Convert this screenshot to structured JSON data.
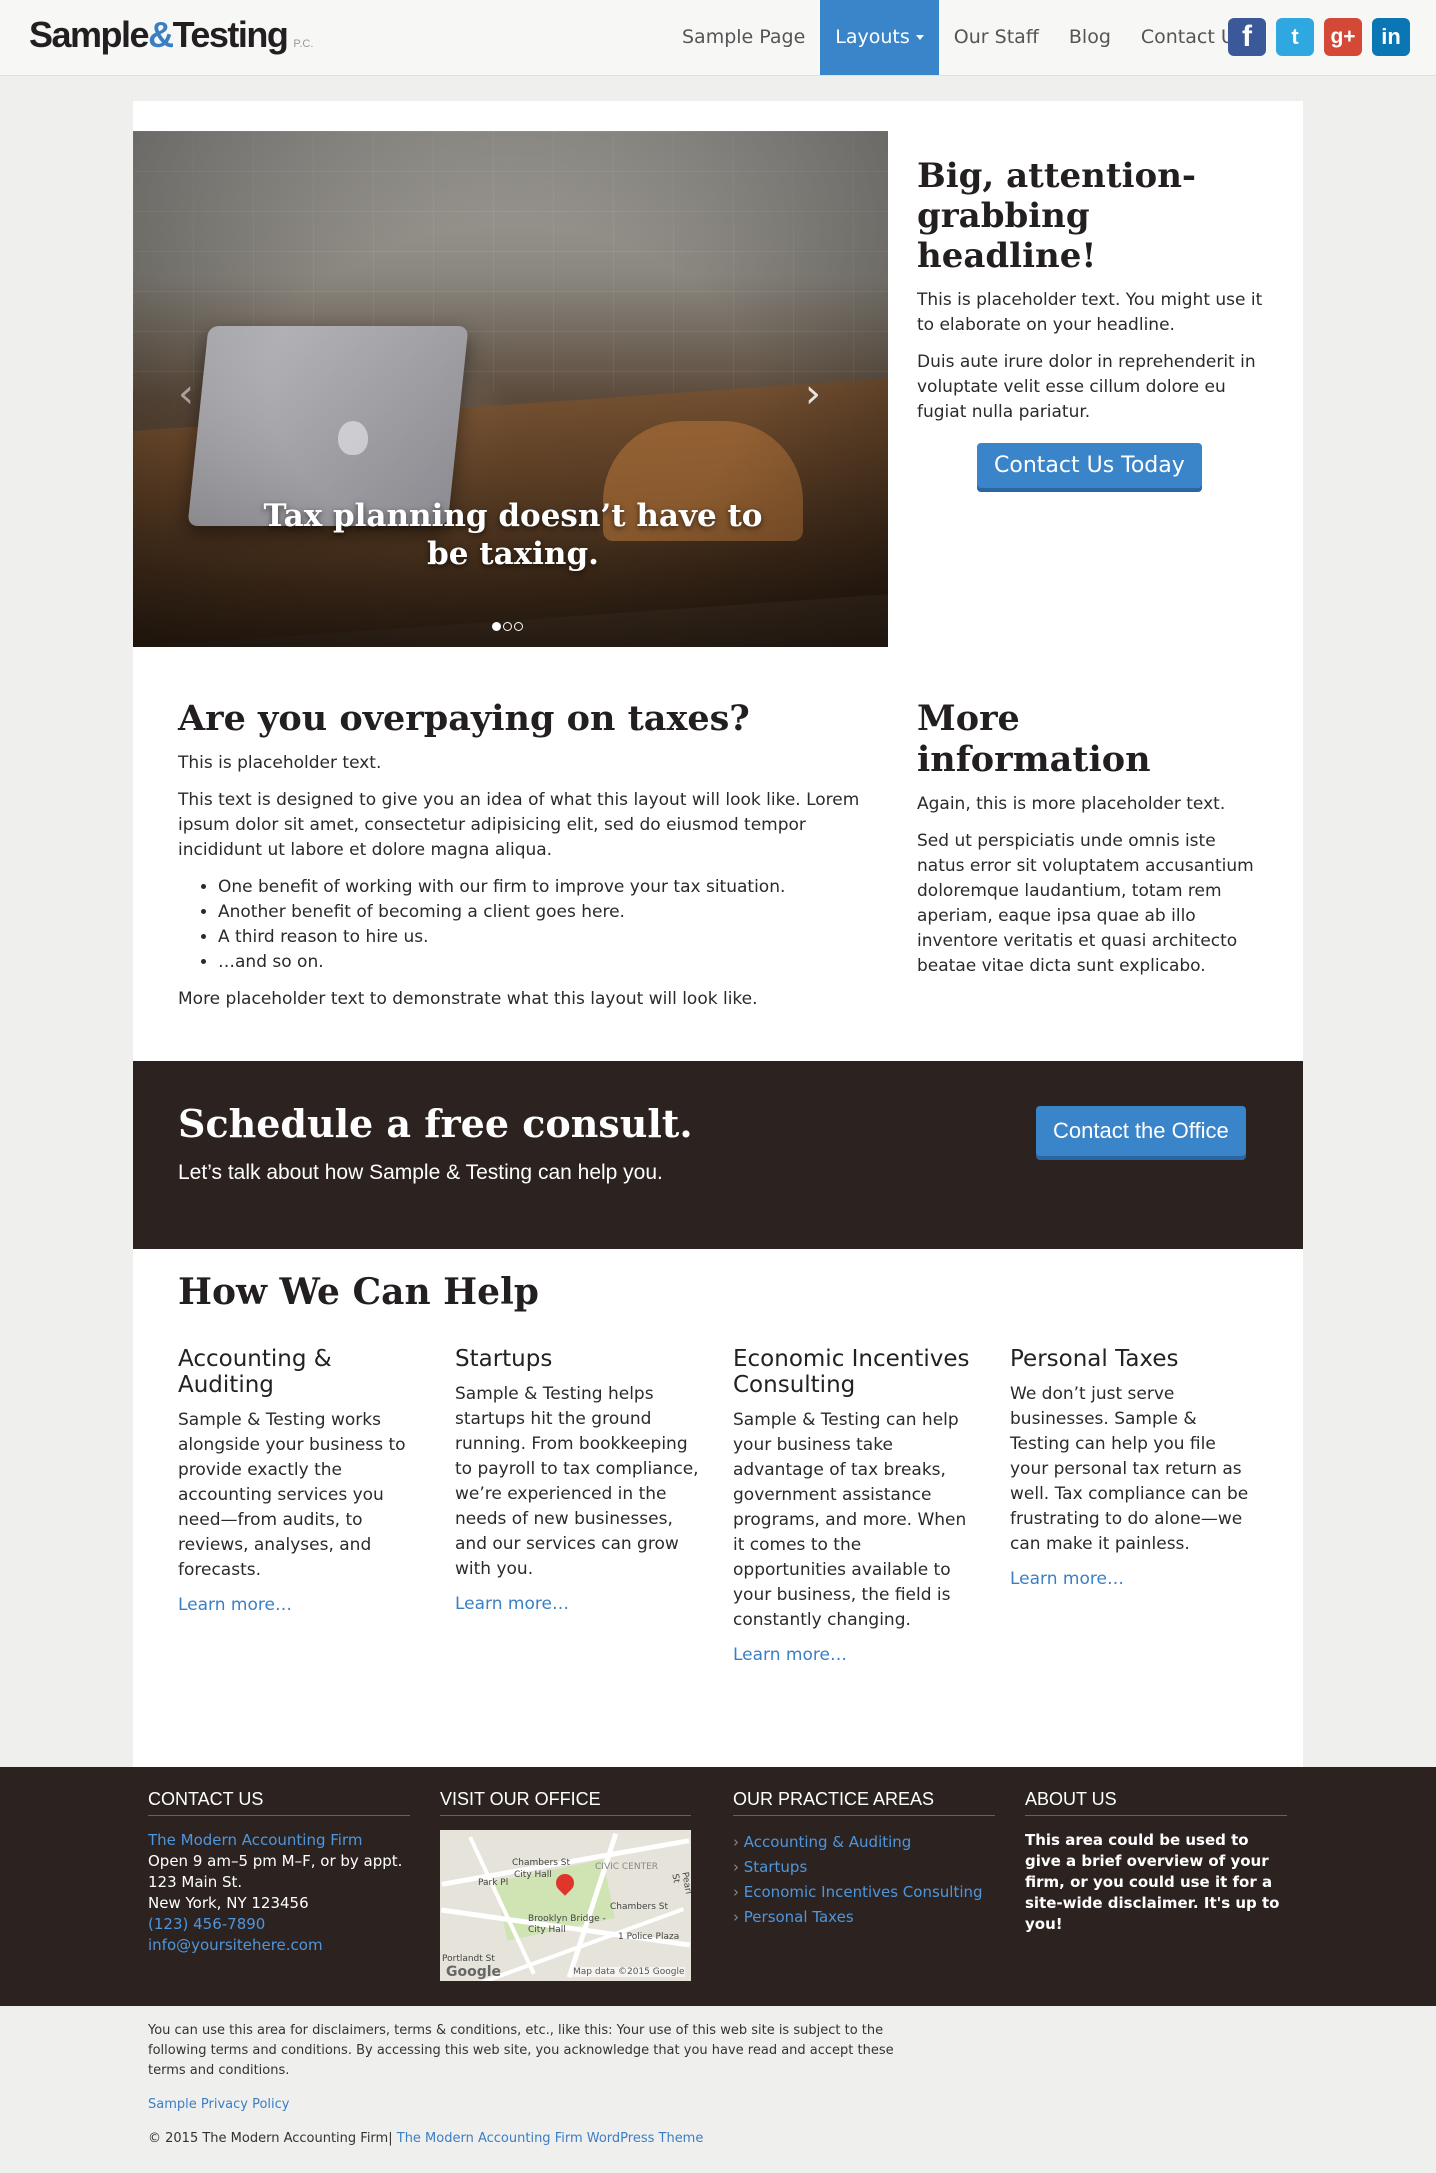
{
  "header": {
    "logo_main": "Sample",
    "logo_amp": "&",
    "logo_second": "Testing",
    "logo_suffix": "P.C.",
    "nav": [
      "Sample Page",
      "Layouts",
      "Our Staff",
      "Blog",
      "Contact Us"
    ],
    "social": [
      "f",
      "t",
      "g+",
      "in"
    ]
  },
  "hero": {
    "caption": "Tax planning doesn’t have to be taxing.",
    "prev": "‹",
    "next": "›",
    "slides": 3,
    "active_slide": 1
  },
  "side": {
    "headline": "Big, attention-grabbing headline!",
    "p1": "This is placeholder text. You might use it to elaborate on your headline.",
    "p2": "Duis aute irure dolor in reprehenderit in voluptate velit esse cillum dolore eu fugiat nulla pariatur.",
    "button": "Contact Us Today"
  },
  "content": {
    "title": "Are you overpaying on taxes?",
    "p1": "This is placeholder text.",
    "p2": "This text is designed to give you an idea of what this layout will look like. Lorem ipsum dolor sit amet, consectetur adipisicing elit, sed do eiusmod tempor incididunt ut labore et dolore magna aliqua.",
    "bullets": [
      "One benefit of working with our firm to improve your tax situation.",
      "Another benefit of becoming a client goes here.",
      "A third reason to hire us.",
      "…and so on."
    ],
    "p3": "More placeholder text to demonstrate what this layout will look like."
  },
  "more": {
    "title": "More information",
    "p1": "Again, this is more placeholder text.",
    "p2": "Sed ut perspiciatis unde omnis iste natus error sit voluptatem accusantium doloremque laudantium, totam rem aperiam, eaque ipsa quae ab illo inventore veritatis et quasi architecto beatae vitae dicta sunt explicabo."
  },
  "cta": {
    "title": "Schedule a free consult.",
    "text": "Let’s talk about how Sample & Testing can help you.",
    "button": "Contact the Office"
  },
  "help": {
    "title": "How We Can Help",
    "cols": [
      {
        "title": "Accounting & Auditing",
        "text": "Sample & Testing works alongside your business to provide exactly the accounting services you need—from audits, to reviews, analyses, and forecasts.",
        "link": "Learn more…"
      },
      {
        "title": "Startups",
        "text": "Sample & Testing helps startups hit the ground running. From bookkeeping to payroll to tax compliance, we’re experienced in the needs of new businesses, and our services can grow with you.",
        "link": "Learn more…"
      },
      {
        "title": "Economic Incentives Consulting",
        "text": "Sample & Testing can help your business take advantage of tax breaks, government assistance programs, and more. When it comes to the opportunities available to your business, the field is constantly changing.",
        "link": "Learn more…"
      },
      {
        "title": "Personal Taxes",
        "text": "We don’t just serve businesses. Sample & Testing can help you file your personal tax return as well. Tax compliance can be frustrating to do alone—we can make it painless.",
        "link": "Learn more…"
      }
    ]
  },
  "footer": {
    "contact": {
      "title": "CONTACT US",
      "firm": "The Modern Accounting Firm",
      "hours": "Open 9 am–5 pm M–F, or by appt.",
      "street": "123 Main St.",
      "city": "New York, NY 123456",
      "phone": "(123) 456-7890",
      "email": "info@yoursitehere.com"
    },
    "office": {
      "title": "VISIT OUR OFFICE",
      "map_labels": [
        "Chambers St",
        "City Hall",
        "Park Pl",
        "CIVIC CENTER",
        "Chambers St",
        "Brooklyn Bridge - City Hall",
        "1 Police Plaza",
        "Pearl St",
        "Portlandt St"
      ],
      "map_brand": "Google",
      "map_attr": "Map data ©2015 Google"
    },
    "practice": {
      "title": "OUR PRACTICE AREAS",
      "items": [
        "Accounting & Auditing",
        "Startups",
        "Economic Incentives Consulting",
        "Personal Taxes"
      ]
    },
    "about": {
      "title": "ABOUT US",
      "text": "This area could be used to give a brief overview of your firm, or you could use it for a site-wide disclaimer. It's up to you!"
    }
  },
  "bottom": {
    "disclaimer": "You can use this area for disclaimers, terms & conditions, etc., like this: Your use of this web site is subject to the following terms and conditions. By accessing this web site, you acknowledge that you have read and accept these terms and conditions.",
    "privacy": "Sample Privacy Policy",
    "copyright": "© 2015 The Modern Accounting Firm|",
    "theme_link": "The Modern Accounting Firm WordPress Theme"
  },
  "colors": {
    "accent": "#3a84c9",
    "dark": "#2c2321",
    "background": "#efefee"
  }
}
